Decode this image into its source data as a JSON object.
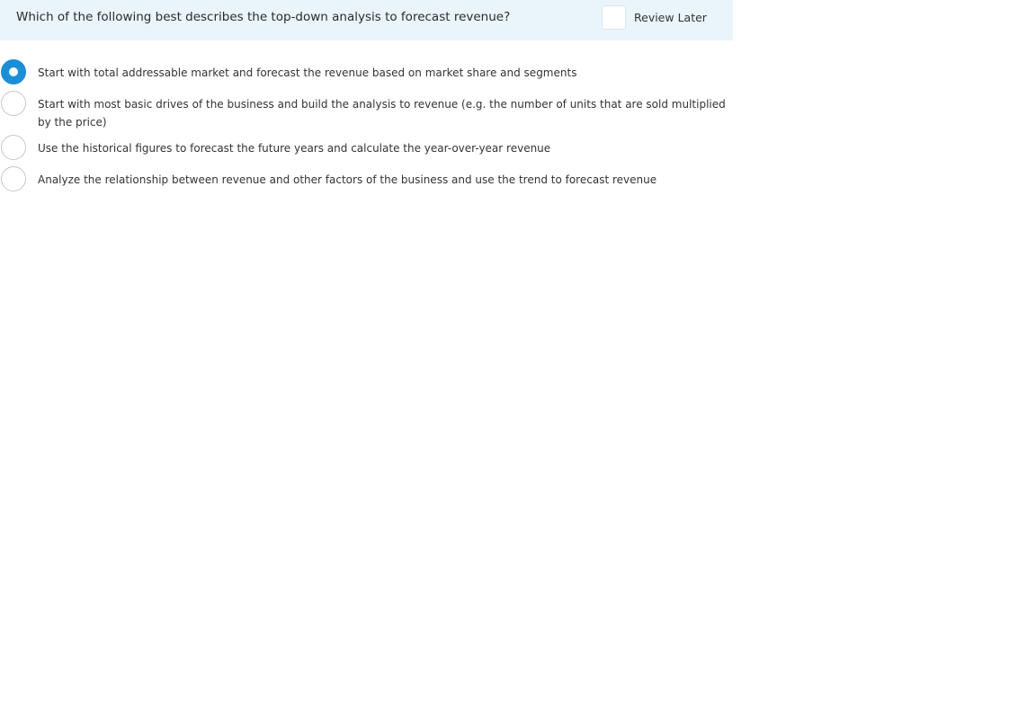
{
  "question": {
    "text": "Which of the following best describes the top-down analysis to forecast revenue?",
    "review_later_label": "Review Later",
    "review_later_checked": false
  },
  "options": [
    {
      "text": "Start with total addressable market and forecast the revenue based on market share and segments",
      "selected": true
    },
    {
      "text": "Start with most basic drives of the business and build the analysis to revenue (e.g. the number of units that are sold multiplied by the price)",
      "selected": false
    },
    {
      "text": "Use the historical figures to forecast the future years and calculate the year-over-year revenue",
      "selected": false
    },
    {
      "text": "Analyze the relationship between revenue and other factors of the business and use the trend to forecast revenue",
      "selected": false
    }
  ],
  "colors": {
    "accent": "#1a8fd6",
    "question_bar_bg": "#eaf4fb"
  }
}
